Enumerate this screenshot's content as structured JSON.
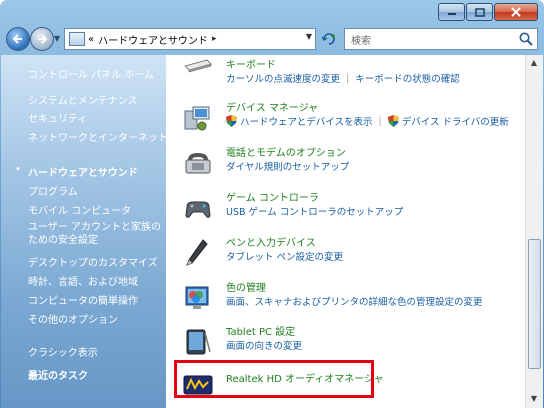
{
  "window": {
    "title_buttons": [
      "minimize",
      "maximize",
      "close"
    ]
  },
  "toolbar": {
    "back_icon": "back-arrow-icon",
    "forward_icon": "forward-arrow-icon",
    "address": {
      "prefix": "«",
      "path": "ハードウェアとサウンド",
      "separator": "▸"
    },
    "search_placeholder": "検索"
  },
  "sidebar": {
    "items": [
      {
        "label": "コントロール パネル ホーム"
      },
      {
        "label": "システムとメンテナンス"
      },
      {
        "label": "セキュリティ"
      },
      {
        "label": "ネットワークとインターネット"
      },
      {
        "label": "ハードウェアとサウンド",
        "current": true
      },
      {
        "label": "プログラム"
      },
      {
        "label": "モバイル コンピュータ"
      },
      {
        "label": "ユーザー アカウントと家族のための安全設定"
      },
      {
        "label": "デスクトップのカスタマイズ"
      },
      {
        "label": "時計、言語、および地域"
      },
      {
        "label": "コンピュータの簡単操作"
      },
      {
        "label": "その他のオプション"
      }
    ],
    "classic_view": "クラシック表示",
    "recent_tasks": "最近のタスク"
  },
  "categories": [
    {
      "title": "キーボード",
      "links": [
        "カーソルの点滅速度の変更",
        "キーボードの状態の確認"
      ],
      "icon": "keyboard-icon"
    },
    {
      "title": "デバイス マネージャ",
      "links": [
        "ハードウェアとデバイスを表示",
        "デバイス ドライバの更新"
      ],
      "icon": "device-manager-icon",
      "shield_links": true
    },
    {
      "title": "電話とモデムのオプション",
      "links": [
        "ダイヤル規則のセットアップ"
      ],
      "icon": "phone-modem-icon"
    },
    {
      "title": "ゲーム コントローラ",
      "links": [
        "USB ゲーム コントローラのセットアップ"
      ],
      "icon": "gamepad-icon"
    },
    {
      "title": "ペンと入力デバイス",
      "links": [
        "タブレット ペン設定の変更"
      ],
      "icon": "pen-icon"
    },
    {
      "title": "色の管理",
      "links": [
        "画面、スキャナおよびプリンタの詳細な色の管理設定の変更"
      ],
      "icon": "color-management-icon"
    },
    {
      "title": "Tablet PC 設定",
      "links": [
        "画面の向きの変更"
      ],
      "icon": "tablet-pc-icon"
    },
    {
      "title": "Realtek HD オーディオマネージャ",
      "links": [],
      "icon": "realtek-audio-icon"
    }
  ]
}
